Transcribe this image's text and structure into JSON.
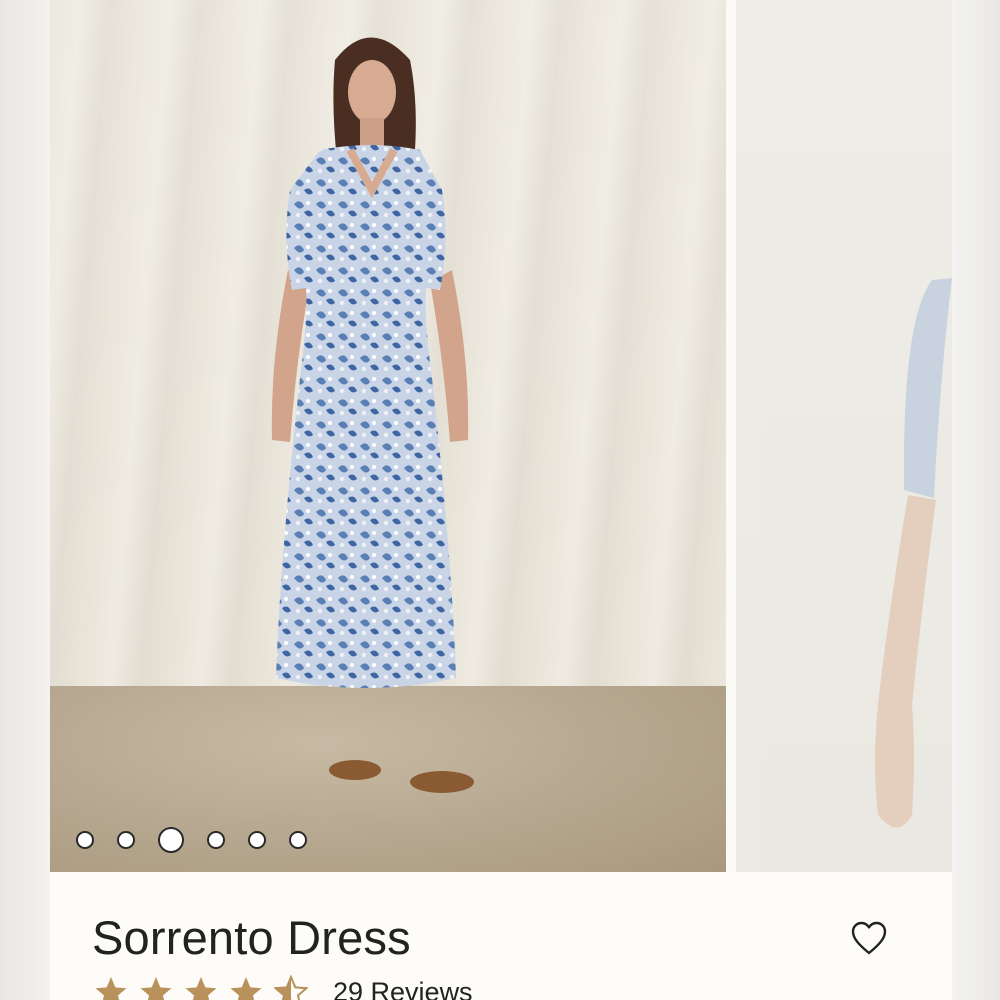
{
  "product": {
    "title": "Sorrento Dress",
    "reviews_label": "29 Reviews",
    "rating": 4.5,
    "rating_max": 5
  },
  "carousel": {
    "slide_count": 6,
    "active_index": 2
  },
  "colors": {
    "star": "#b9915a",
    "dress": "#8fa6c4",
    "text": "#222222"
  },
  "icons": {
    "wishlist": "heart-outline-icon",
    "rating": "star-icon"
  }
}
